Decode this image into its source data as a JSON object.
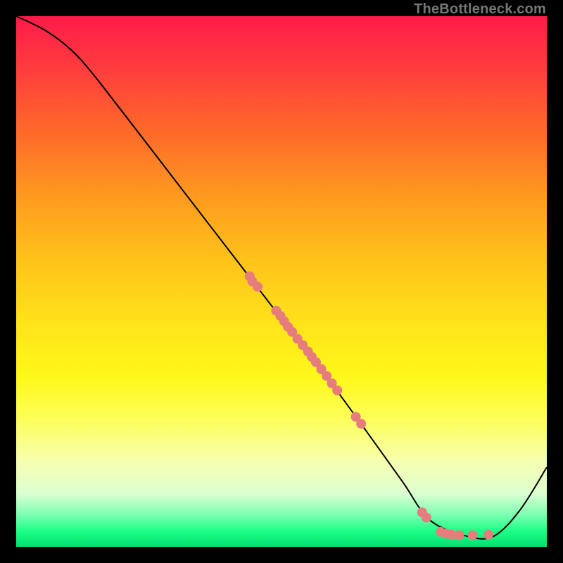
{
  "attribution": "TheBottleneck.com",
  "colors": {
    "dot": "#e77c7c",
    "curve": "#000000"
  },
  "chart_data": {
    "type": "line",
    "title": "",
    "xlabel": "",
    "ylabel": "",
    "xlim": [
      0,
      100
    ],
    "ylim": [
      0,
      100
    ],
    "series": [
      {
        "name": "curve",
        "x": [
          0,
          6,
          12,
          20,
          30,
          40,
          50,
          60,
          68,
          73,
          78,
          85,
          90,
          95,
          100
        ],
        "y": [
          100,
          97,
          92,
          82,
          69,
          56,
          43,
          30,
          19,
          12,
          5,
          2,
          2,
          7,
          15
        ]
      }
    ],
    "scatter_points": [
      {
        "x": 44.0,
        "y": 51.0
      },
      {
        "x": 44.5,
        "y": 50.0
      },
      {
        "x": 45.5,
        "y": 49.0
      },
      {
        "x": 49.0,
        "y": 44.5
      },
      {
        "x": 49.8,
        "y": 43.5
      },
      {
        "x": 50.5,
        "y": 42.5
      },
      {
        "x": 51.2,
        "y": 41.5
      },
      {
        "x": 52.0,
        "y": 40.5
      },
      {
        "x": 53.0,
        "y": 39.2
      },
      {
        "x": 54.0,
        "y": 38.0
      },
      {
        "x": 55.0,
        "y": 36.8
      },
      {
        "x": 55.7,
        "y": 35.8
      },
      {
        "x": 56.5,
        "y": 34.8
      },
      {
        "x": 57.5,
        "y": 33.5
      },
      {
        "x": 58.5,
        "y": 32.2
      },
      {
        "x": 59.5,
        "y": 30.8
      },
      {
        "x": 60.5,
        "y": 29.5
      },
      {
        "x": 64.0,
        "y": 24.5
      },
      {
        "x": 65.0,
        "y": 23.2
      },
      {
        "x": 76.5,
        "y": 6.5
      },
      {
        "x": 77.3,
        "y": 5.5
      },
      {
        "x": 80.0,
        "y": 2.8
      },
      {
        "x": 81.0,
        "y": 2.5
      },
      {
        "x": 82.0,
        "y": 2.3
      },
      {
        "x": 83.5,
        "y": 2.2
      },
      {
        "x": 86.0,
        "y": 2.2
      },
      {
        "x": 89.0,
        "y": 2.3
      }
    ],
    "dot_radius_px": 7
  }
}
